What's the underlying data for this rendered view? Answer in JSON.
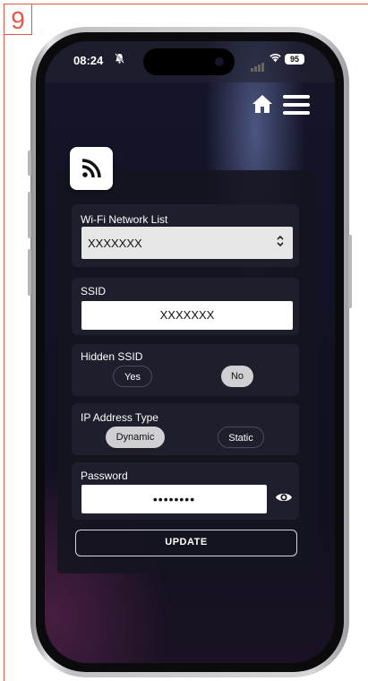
{
  "step_number": "9",
  "status_bar": {
    "time": "08:24",
    "battery": "95",
    "dnd_icon": "bell-slash-icon",
    "signal_icon": "signal-bars-icon",
    "wifi_icon": "wifi-icon"
  },
  "header": {
    "home_icon": "home-icon",
    "menu_icon": "hamburger-menu-icon"
  },
  "app_icon": "rss-feed-icon",
  "form": {
    "wifi_list": {
      "label": "Wi-Fi Network List",
      "selected": "XXXXXXX"
    },
    "ssid": {
      "label": "SSID",
      "value": "XXXXXXX"
    },
    "hidden_ssid": {
      "label": "Hidden SSID",
      "options": [
        "Yes",
        "No"
      ],
      "selected": "No"
    },
    "ip_address_type": {
      "label": "IP Address Type",
      "options": [
        "Dynamic",
        "Static"
      ],
      "selected": "Dynamic"
    },
    "password": {
      "label": "Password",
      "value": "••••••••",
      "toggle_icon": "eye-icon"
    },
    "update_label": "UPDATE"
  },
  "colors": {
    "frame_accent": "#e3564a",
    "card_bg": "#141420",
    "panel_bg": "#1e1e2c",
    "selected_pill": "#d0d0d4"
  }
}
